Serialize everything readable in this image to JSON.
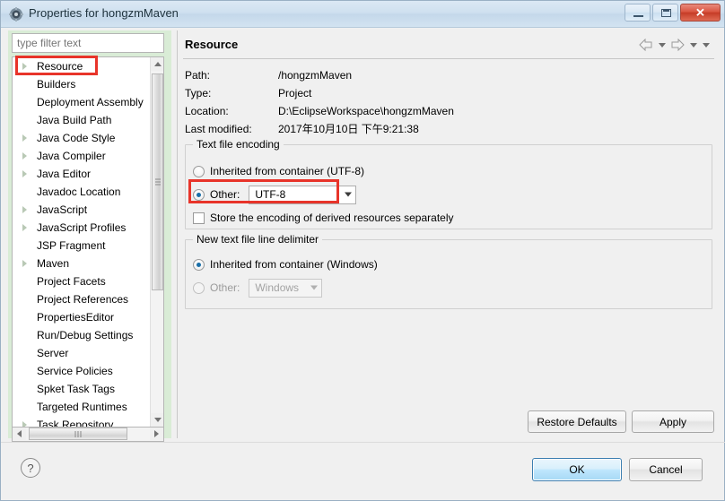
{
  "window": {
    "title": "Properties for hongzmMaven",
    "icon": "properties-gear-icon",
    "minimize_label": "",
    "maximize_label": "",
    "close_label": "✕"
  },
  "sidebar": {
    "filter_placeholder": "type filter text",
    "filter_value": "",
    "items": [
      {
        "label": "Resource",
        "expandable": true,
        "highlighted": true
      },
      {
        "label": "Builders",
        "expandable": false
      },
      {
        "label": "Deployment Assembly",
        "expandable": false
      },
      {
        "label": "Java Build Path",
        "expandable": false
      },
      {
        "label": "Java Code Style",
        "expandable": true
      },
      {
        "label": "Java Compiler",
        "expandable": true
      },
      {
        "label": "Java Editor",
        "expandable": true
      },
      {
        "label": "Javadoc Location",
        "expandable": false
      },
      {
        "label": "JavaScript",
        "expandable": true
      },
      {
        "label": "JavaScript Profiles",
        "expandable": true
      },
      {
        "label": "JSP Fragment",
        "expandable": false
      },
      {
        "label": "Maven",
        "expandable": true
      },
      {
        "label": "Project Facets",
        "expandable": false
      },
      {
        "label": "Project References",
        "expandable": false
      },
      {
        "label": "PropertiesEditor",
        "expandable": false
      },
      {
        "label": "Run/Debug Settings",
        "expandable": false
      },
      {
        "label": "Server",
        "expandable": false
      },
      {
        "label": "Service Policies",
        "expandable": false
      },
      {
        "label": "Spket Task Tags",
        "expandable": false
      },
      {
        "label": "Targeted Runtimes",
        "expandable": false
      },
      {
        "label": "Task Repository",
        "expandable": true
      }
    ]
  },
  "page": {
    "title": "Resource",
    "info": [
      {
        "key": "Path:",
        "value": "/hongzmMaven"
      },
      {
        "key": "Type:",
        "value": "Project"
      },
      {
        "key": "Location:",
        "value": "D:\\EclipseWorkspace\\hongzmMaven"
      },
      {
        "key": "Last modified:",
        "value": "2017年10月10日 下午9:21:38"
      }
    ],
    "encoding_group": {
      "legend": "Text file encoding",
      "inherited_label": "Inherited from container (UTF-8)",
      "other_label": "Other:",
      "other_value": "UTF-8",
      "store_derived_label": "Store the encoding of derived resources separately"
    },
    "delimiter_group": {
      "legend": "New text file line delimiter",
      "inherited_label": "Inherited from container (Windows)",
      "other_label": "Other:",
      "other_value": "Windows"
    },
    "restore_defaults_label": "Restore Defaults",
    "apply_label": "Apply"
  },
  "footer": {
    "help_label": "?",
    "ok_label": "OK",
    "cancel_label": "Cancel"
  },
  "colors": {
    "annotation": "#e8342a",
    "accent": "#1a6fa8",
    "sidebar_bg": "#d9ecd6"
  }
}
